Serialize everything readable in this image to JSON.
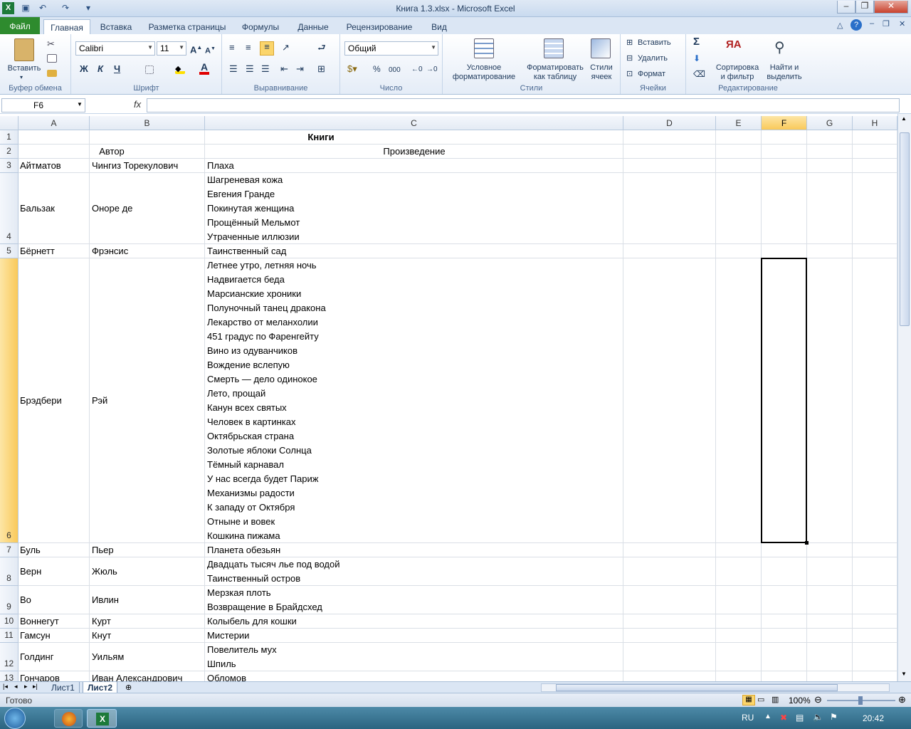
{
  "window": {
    "title": "Книга 1.3.xlsx  -  Microsoft Excel"
  },
  "tabs": [
    "Файл",
    "Главная",
    "Вставка",
    "Разметка страницы",
    "Формулы",
    "Данные",
    "Рецензирование",
    "Вид"
  ],
  "ribbon": {
    "clipboard": {
      "paste": "Вставить",
      "label": "Буфер обмена"
    },
    "font": {
      "name": "Calibri",
      "size": "11",
      "bold": "Ж",
      "italic": "К",
      "underline": "Ч",
      "label": "Шрифт"
    },
    "alignment": {
      "label": "Выравнивание"
    },
    "number": {
      "format": "Общий",
      "percent": "%",
      "thousands": "000",
      "label": "Число"
    },
    "styles": {
      "conditional": "Условное форматирование",
      "table": "Форматировать как таблицу",
      "cell_styles": "Стили ячеек",
      "label": "Стили"
    },
    "cells": {
      "insert": "Вставить",
      "delete": "Удалить",
      "format": "Формат",
      "label": "Ячейки"
    },
    "editing": {
      "sum": "Σ",
      "sort": "Сортировка и фильтр",
      "find": "Найти и выделить",
      "label": "Редактирование"
    }
  },
  "formula_bar": {
    "name_box": "F6",
    "fx": "fx",
    "value": ""
  },
  "columns": [
    "A",
    "B",
    "C",
    "D",
    "E",
    "F",
    "G",
    "H"
  ],
  "selected_cell": "F6",
  "rows": [
    {
      "num": "1",
      "a": "",
      "b": "",
      "c": "",
      "title": "Книги",
      "lines": 1
    },
    {
      "num": "2",
      "a": "",
      "b": "Автор",
      "c": "Произведение",
      "header": true,
      "lines": 1
    },
    {
      "num": "3",
      "a": "Айтматов",
      "b": "Чингиз Торекулович",
      "works": [
        "Плаха"
      ]
    },
    {
      "num": "4",
      "a": "Бальзак",
      "b": "Оноре де",
      "works": [
        "Шагреневая кожа",
        "Евгения Гранде",
        "Покинутая женщина",
        "Прощённый Мельмот",
        "Утраченные иллюзии"
      ]
    },
    {
      "num": "5",
      "a": "Бёрнетт",
      "b": "Фрэнсис",
      "works": [
        "Таинственный сад"
      ]
    },
    {
      "num": "6",
      "a": "Брэдбери",
      "b": "Рэй",
      "works": [
        "Летнее утро, летняя ночь",
        "Надвигается беда",
        "Марсианские хроники",
        "Полуночный танец дракона",
        "Лекарство от меланхолии",
        "451 градус по Фаренгейту",
        "Вино из одуванчиков",
        "Вождение вслепую",
        "Смерть — дело одинокое",
        "Лето, прощай",
        "Канун всех святых",
        "Человек в картинках",
        "Октябрьская страна",
        "Золотые яблоки Солнца",
        "Тёмный карнавал",
        "У нас всегда будет Париж",
        "Механизмы радости",
        "К западу от Октября",
        "Отныне и вовек",
        "Кошкина пижама"
      ]
    },
    {
      "num": "7",
      "a": "Буль",
      "b": "Пьер",
      "works": [
        "Планета обезьян"
      ]
    },
    {
      "num": "8",
      "a": "Верн",
      "b": "Жюль",
      "works": [
        "Двадцать тысяч лье под водой",
        "Таинственный остров"
      ]
    },
    {
      "num": "9",
      "a": "Во",
      "b": "Ивлин",
      "works": [
        "Мерзкая плоть",
        "Возвращение в Брайдсхед"
      ]
    },
    {
      "num": "10",
      "a": "Воннегут",
      "b": "Курт",
      "works": [
        "Колыбель для кошки"
      ]
    },
    {
      "num": "11",
      "a": "Гамсун",
      "b": "Кнут",
      "works": [
        "Мистерии"
      ]
    },
    {
      "num": "12",
      "a": "Голдинг",
      "b": "Уильям",
      "works": [
        "Повелитель мух",
        "Шпиль"
      ]
    },
    {
      "num": "13",
      "a": "Гончаров",
      "b": "Иван Александрович",
      "works": [
        "Обломов"
      ]
    }
  ],
  "sheets": [
    "Лист1",
    "Лист2"
  ],
  "active_sheet": "Лист2",
  "status": {
    "ready": "Готово",
    "zoom": "100%"
  },
  "taskbar": {
    "lang": "RU",
    "time": "20:42"
  }
}
